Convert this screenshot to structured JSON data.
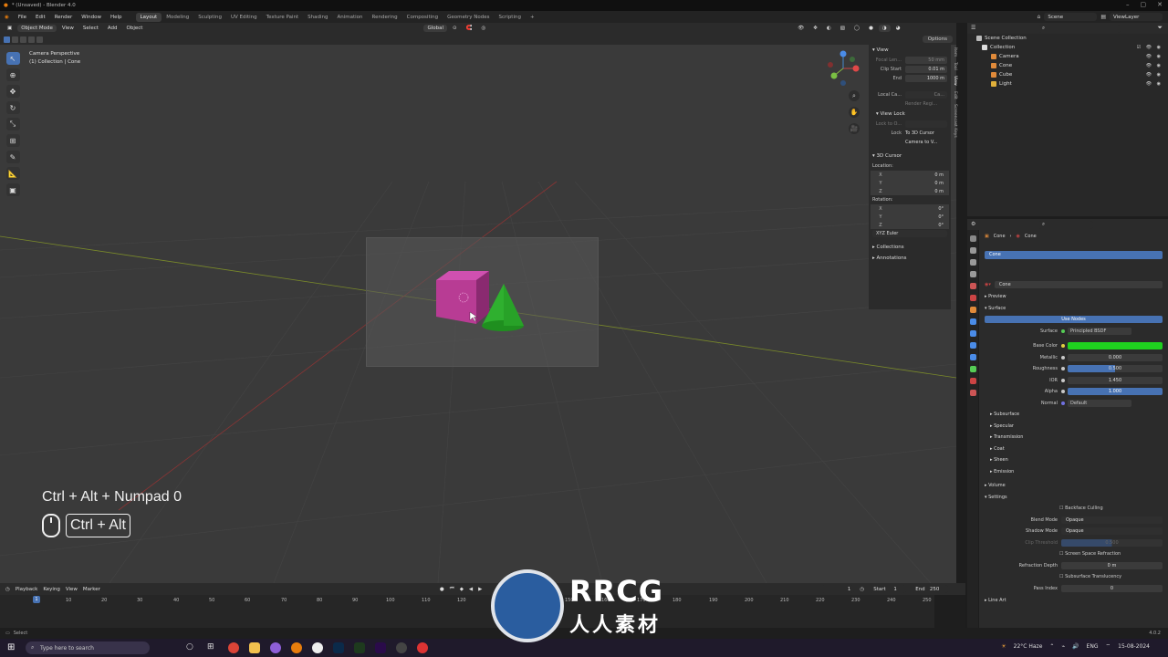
{
  "window": {
    "title": "* (Unsaved) - Blender 4.0",
    "controls": [
      "–",
      "▢",
      "✕"
    ]
  },
  "menus": [
    "File",
    "Edit",
    "Render",
    "Window",
    "Help"
  ],
  "workspaces": [
    "Layout",
    "Modeling",
    "Sculpting",
    "UV Editing",
    "Texture Paint",
    "Shading",
    "Animation",
    "Rendering",
    "Compositing",
    "Geometry Nodes",
    "Scripting"
  ],
  "workspace_add": "+",
  "scene": {
    "name": "Scene",
    "view_layer": "ViewLayer"
  },
  "viewport_header": {
    "mode": "Object Mode",
    "menus": [
      "View",
      "Select",
      "Add",
      "Object"
    ],
    "orientation": "Global",
    "options": "Options"
  },
  "viewport": {
    "info_line1": "Camera Perspective",
    "info_line2": "(1) Collection | Cone"
  },
  "npanel": {
    "view_title": "View",
    "focal_label": "Focal Len...",
    "focal_value": "50 mm",
    "clip_start_label": "Clip Start",
    "clip_start_value": "0.01 m",
    "clip_end_label": "End",
    "clip_end_value": "1000 m",
    "local_camera_label": "Local Ca...",
    "local_camera_value": "Ca...",
    "render_region": "Render Regi...",
    "view_lock_title": "View Lock",
    "lock_to_label": "Lock to O...",
    "lock_label": "Lock",
    "lock_3d_cursor": "To 3D Cursor",
    "lock_camera": "Camera to V...",
    "cursor_title": "3D Cursor",
    "location_label": "Location:",
    "loc_x": "0 m",
    "loc_y": "0 m",
    "loc_z": "0 m",
    "rotation_label": "Rotation:",
    "rot_x": "0°",
    "rot_y": "0°",
    "rot_z": "0°",
    "rotation_mode": "XYZ Euler",
    "collections": "Collections",
    "annotations": "Annotations",
    "tabs": [
      "Item",
      "Tool",
      "View",
      "Edit",
      "Screencast Keys"
    ]
  },
  "shortcut_overlay": {
    "line1": "Ctrl + Alt + Numpad 0",
    "line2": "Ctrl + Alt"
  },
  "outliner": {
    "root": "Scene Collection",
    "collection": "Collection",
    "items": [
      "Camera",
      "Cone",
      "Cube",
      "Light"
    ]
  },
  "properties": {
    "object_path_1": "Cone",
    "object_path_2": "Cone",
    "material_slot": "Cone",
    "material_name": "Cone",
    "preview": "Preview",
    "surface_section": "Surface",
    "use_nodes": "Use Nodes",
    "surface_label": "Surface",
    "surface_value": "Principled BSDF",
    "base_color_label": "Base Color",
    "metallic_label": "Metallic",
    "metallic_value": "0.000",
    "roughness_label": "Roughness",
    "roughness_value": "0.500",
    "ior_label": "IOR",
    "ior_value": "1.450",
    "alpha_label": "Alpha",
    "alpha_value": "1.000",
    "normal_label": "Normal",
    "normal_value": "Default",
    "subsections": [
      "Subsurface",
      "Specular",
      "Transmission",
      "Coat",
      "Sheen",
      "Emission"
    ],
    "volume": "Volume",
    "settings": "Settings",
    "backface_culling": "Backface Culling",
    "blend_mode_label": "Blend Mode",
    "blend_mode_value": "Opaque",
    "shadow_mode_label": "Shadow Mode",
    "shadow_mode_value": "Opaque",
    "clip_threshold_label": "Clip Threshold",
    "clip_threshold_value": "0.500",
    "screen_space_refraction": "Screen Space Refraction",
    "refraction_depth_label": "Refraction Depth",
    "refraction_depth_value": "0 m",
    "subsurface_translucency": "Subsurface Translucency",
    "pass_index_label": "Pass Index",
    "pass_index_value": "0",
    "line_art": "Line Art"
  },
  "timeline": {
    "menus": [
      "Playback",
      "Keying",
      "View",
      "Marker"
    ],
    "current_frame": "1",
    "start_label": "Start",
    "start_value": "1",
    "end_label": "End",
    "end_value": "250",
    "ticks": [
      "10",
      "20",
      "30",
      "40",
      "50",
      "60",
      "70",
      "80",
      "90",
      "100",
      "110",
      "120",
      "130",
      "140",
      "150",
      "160",
      "170",
      "180",
      "190",
      "200",
      "210",
      "220",
      "230",
      "240",
      "250"
    ],
    "cursor_value": "1"
  },
  "statusbar": {
    "select": "Select",
    "version": "4.0.2"
  },
  "taskbar": {
    "search_placeholder": "Type here to search",
    "weather": "22°C Haze",
    "lang": "ENG",
    "date": "15-08-2024"
  },
  "watermark": {
    "title": "RRCG",
    "subtitle": "人人素材"
  },
  "colors": {
    "accent": "#4772b3",
    "base_color": "#1fd11f",
    "cube": "#b83c94",
    "cone": "#2fb02f"
  }
}
